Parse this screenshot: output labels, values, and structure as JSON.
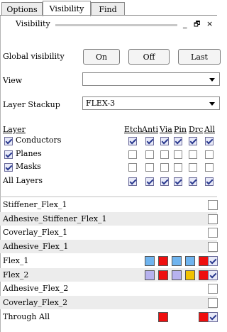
{
  "tabs": [
    "Options",
    "Visibility",
    "Find"
  ],
  "panel": {
    "title": "Visibility",
    "minimize": "_",
    "float": "🗗",
    "close": "×"
  },
  "global_visibility": {
    "label": "Global visibility",
    "on": "On",
    "off": "Off",
    "last": "Last"
  },
  "view": {
    "label": "View",
    "value": ""
  },
  "stackup": {
    "label": "Layer Stackup",
    "value": "FLEX-3"
  },
  "columns": [
    "Etch",
    "Anti",
    "Via",
    "Pin",
    "Drc",
    "All"
  ],
  "layer_header": "Layer",
  "groups": [
    {
      "label": "Conductors",
      "checked": true,
      "cols": [
        true,
        true,
        true,
        true,
        true,
        true
      ]
    },
    {
      "label": "Planes",
      "checked": true,
      "cols": [
        false,
        false,
        false,
        false,
        false,
        false
      ]
    },
    {
      "label": "Masks",
      "checked": true,
      "cols": [
        false,
        false,
        false,
        false,
        false,
        false
      ]
    },
    {
      "label": "All Layers",
      "cols": [
        true,
        true,
        true,
        true,
        true,
        true
      ]
    }
  ],
  "layers": [
    {
      "name": "Stiffener_Flex_1",
      "swatches": [],
      "checked": false
    },
    {
      "name": "Adhesive_Stiffener_Flex_1",
      "swatches": [],
      "checked": false
    },
    {
      "name": "Coverlay_Flex_1",
      "swatches": [],
      "checked": false
    },
    {
      "name": "Adhesive_Flex_1",
      "swatches": [],
      "checked": false
    },
    {
      "name": "Flex_1",
      "swatches": [
        "#6fb4ef",
        "#ef0e0e",
        "#6fb4ef",
        "#6fb4ef",
        "#ef0e0e"
      ],
      "checked": true
    },
    {
      "name": "Flex_2",
      "swatches": [
        "#b7b2ee",
        "#ef0e0e",
        "#b7b2ee",
        "#f1c200",
        "#ef0e0e"
      ],
      "checked": true
    },
    {
      "name": "Adhesive_Flex_2",
      "swatches": [],
      "checked": false
    },
    {
      "name": "Coverlay_Flex_2",
      "swatches": [],
      "checked": false
    },
    {
      "name": "Through All",
      "swatches": [
        null,
        "#ef0e0e",
        null,
        null,
        "#ef0e0e"
      ],
      "checked": true
    }
  ]
}
